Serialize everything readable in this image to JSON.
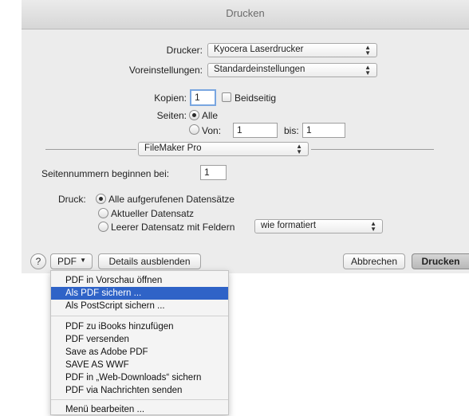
{
  "window": {
    "title": "Drucken"
  },
  "printer": {
    "label": "Drucker:",
    "value": "Kyocera Laserdrucker"
  },
  "presets": {
    "label": "Voreinstellungen:",
    "value": "Standardeinstellungen"
  },
  "copies": {
    "label": "Kopien:",
    "value": "1",
    "duplex_label": "Beidseitig"
  },
  "pages": {
    "label": "Seiten:",
    "all_label": "Alle",
    "from_label": "Von:",
    "from_value": "1",
    "to_label": "bis:",
    "to_value": "1"
  },
  "section": {
    "value": "FileMaker Pro"
  },
  "page_number": {
    "label": "Seitennummern beginnen bei:",
    "value": "1"
  },
  "print": {
    "label": "Druck:",
    "options": [
      "Alle aufgerufenen Datensätze",
      "Aktueller Datensatz",
      "Leerer Datensatz mit Feldern"
    ],
    "format_value": "wie formatiert"
  },
  "buttons": {
    "help": "?",
    "pdf": "PDF",
    "details": "Details ausblenden",
    "cancel": "Abbrechen",
    "print": "Drucken"
  },
  "pdf_menu": {
    "items": [
      "PDF in Vorschau öffnen",
      "Als PDF sichern ...",
      "Als PostScript sichern ...",
      "PDF zu iBooks hinzufügen",
      "PDF versenden",
      "Save as Adobe PDF",
      "SAVE AS WWF",
      "PDF in „Web-Downloads“ sichern",
      "PDF via Nachrichten senden",
      "Menü bearbeiten ..."
    ]
  },
  "colors": {
    "highlight": "#2f63c7",
    "dialog_bg": "#ececec"
  }
}
